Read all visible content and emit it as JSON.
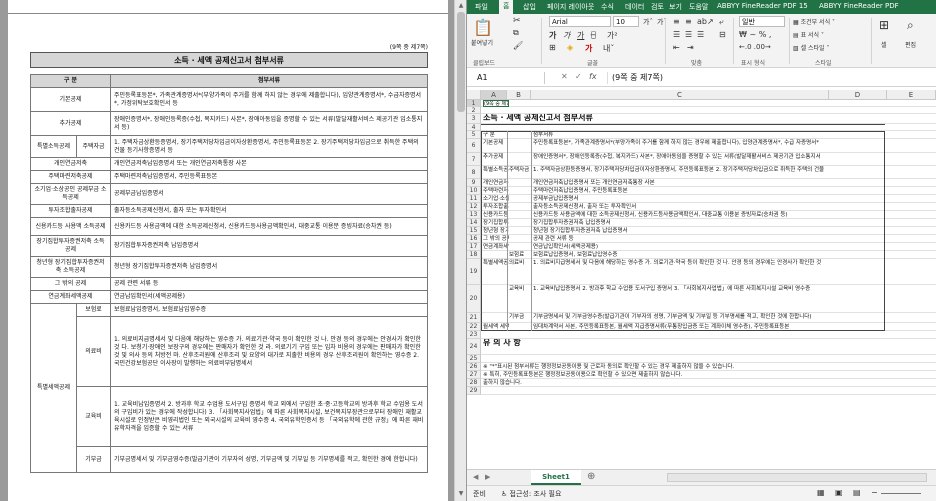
{
  "doc": {
    "page_mark": "(9쪽 중 제7쪽)",
    "title": "소득 · 세액 공제신고서 첨부서류",
    "col1": "구 분",
    "col2": "첨부서류",
    "rows": [
      {
        "a": "기본공제",
        "b": "",
        "c": "주민등록표등본*, 가족관계증명서*(부양가족이 주거를 함께 하지 않는 경우에 제출합니다), 입양관계증명서*, 수급자증명서*, 가정위탁보호확인서 등"
      },
      {
        "a": "추가공제",
        "b": "",
        "c": "장애인증명서*, 장애인등록증(수첩, 복지카드) 사본*, 장애아동임을 증명할 수 있는 서류(발달재활서비스 제공기관 입소통지서 등)"
      },
      {
        "a": "특별소득공제",
        "b": "주택자금",
        "c": "1. 주택자금상환등증명서, 장기주택저당차입금이자상환증명서, 주민등록표등본  2. 장기주택저당차입금으로 취득한 주택의 건물 등기사항증명서 등"
      },
      {
        "a": "개인연금저축",
        "b": "",
        "c": "개인연금저축납입증명서 또는 개인연금저축통장 사본"
      },
      {
        "a": "주택마련저축공제",
        "b": "",
        "c": "주택마련저축납입증명서, 주민등록표등본"
      },
      {
        "a": "소기업·소상공인 공제부금 소득공제",
        "b": "",
        "c": "공제부금납입증명서"
      },
      {
        "a": "투자조합출자공제",
        "b": "",
        "c": "출자등소득공제신청서, 출자 또는 투자확인서"
      },
      {
        "a": "신용카드등 사용액 소득공제",
        "b": "",
        "c": "신용카드등 사용금액에 대한 소득공제신청서, 신용카드등사용금액확인서, 대중교통 이용분 증빙자료(승차권 등)"
      },
      {
        "a": "장기집합투자증권저축 소득공제",
        "b": "",
        "c": "장기집합투자증권저축 납입증명서"
      },
      {
        "a": "청년형 장기집합투자증권저축 소득공제",
        "b": "",
        "c": "청년형 장기집합투자증권저축 납입증명서"
      },
      {
        "a": "그 밖의 공제",
        "b": "",
        "c": "공제 관련 서류 등"
      },
      {
        "a": "연금계좌세액공제",
        "b": "",
        "c": "연금납입확인서(세액공제용)"
      },
      {
        "a": "특별세액공제",
        "b": "보험료",
        "c": "보험료납입증명서, 보험료납입영수증"
      },
      {
        "a": "",
        "b": "의료비",
        "c": "1. 의료비지급명세서 및 다음에 해당하는 영수증  가. 의료기관·약국 등이 확인한 것  나. 안경 등의 경우에는 안경사가 확인한 것  다. 보청기·장애인 보장구의 경우에는 판매자가 확인한 것  라. 의료기기 구입 또는 임차 비용의 경우에는 판매자가 확인한 것 및 의사 등의 처방전  마. 산후조리원에 산후조리 및 요양의 대가로 지출한 비용의 경우 산후조리원이 확인하는 영수증  2. 국민건강보험공단 이사장이 발행하는 의료비부담명세서"
      },
      {
        "a": "",
        "b": "교육비",
        "c": "1. 교육비납입증명서  2. 방과후 학교 수업용 도서구입 증명서 학교 외에서 구입한 초·중·고등학교의 방과후 학교 수업용 도서의 구입비가 있는 경우에 작성합니다)  3. 「사회복지사업법」에 따른 사회복지시설, 보건복지부장관으로부터 장애인 재활교육시설로 인정받은 비영리법인 또는 외국시설의 교육비 영수증  4. 국외유학인증서 등 「국외유학에 관한 규정」에 따른 재비유학자격을 입증할 수 있는 서류"
      },
      {
        "a": "",
        "b": "기부금",
        "c": "기부금명세서 및 기부금영수증(발급기관이 기부자의 성명, 기부금액 및 기부일 등 기부명세를 적고, 확인한 경에 한합니다)"
      }
    ]
  },
  "excel": {
    "tabs": [
      "파일",
      "홈",
      "삽입",
      "페이지 레이아웃",
      "수식",
      "데이터",
      "검토",
      "보기",
      "도움말",
      "ABBYY FineReader PDF 15",
      "ABBYY FineReader PDF"
    ],
    "ribbon": {
      "paste": "붙여넣기",
      "font_name": "Arial",
      "font_size": "10",
      "number_format": "일반",
      "cond_format": "조건부 서식",
      "table_format": "표 서식",
      "cell_style": "셀 스타일",
      "cell": "셀",
      "edit": "편집",
      "groups": [
        "클립보드",
        "글꼴",
        "맞춤",
        "표시 형식",
        "스타일"
      ]
    },
    "namebox": "A1",
    "formula": "(9쪽 중 제7쪽)",
    "fx": "fx",
    "columns": [
      "A",
      "B",
      "C",
      "D",
      "E"
    ],
    "cells": [
      {
        "r": "1",
        "t": "(9쪽 중 제7쪽)"
      },
      {
        "r": "3",
        "t": "소득 · 세액 공제신고서 첨부서류"
      },
      {
        "r": "5a",
        "t": "구 분"
      },
      {
        "r": "5c",
        "t": "첨부서류"
      },
      {
        "r": "6a",
        "t": "기본공제"
      },
      {
        "r": "6c",
        "t": "주민등록표등본*, 가족관계증명서*(부양가족이 주거를 함께 하지 않는 경우에 제출합니다), 입양관계증명서*, 수급 자증명서*"
      },
      {
        "r": "7a",
        "t": "추가공제"
      },
      {
        "r": "7c",
        "t": "장애인증명서*, 장애인등록증(수첩, 복지카드) 사본*, 장애아동임을 증명할 수 있는 서류(발달재활서비스 제공기관 입소통지서"
      },
      {
        "r": "8a",
        "t": "특별소득공제"
      },
      {
        "r": "8b",
        "t": "주택자금"
      },
      {
        "r": "8c",
        "t": "1. 주택자금상환등증명서, 장기주택저당차입금이자상환증명서, 주민등록표등본 2. 장기주택저당차입금으로 취득한 주택의 건물"
      },
      {
        "r": "9a",
        "t": "개인연금저축공제"
      },
      {
        "r": "9c",
        "t": "개인연금저축납입증명서 또는 개인연금저축통장 사본"
      },
      {
        "r": "10a",
        "t": "주택마련저축공제"
      },
      {
        "r": "10c",
        "t": "주택마련저축납입증명서, 주민등록표등본"
      },
      {
        "r": "11a",
        "t": "소기업·소상공인 공"
      },
      {
        "r": "11c",
        "t": "공제부금납입증명서"
      },
      {
        "r": "12a",
        "t": "투자조합출자공제"
      },
      {
        "r": "12c",
        "t": "출자등소득공제신청서, 출자 또는 투자확인서"
      },
      {
        "r": "13a",
        "t": "신용카드등 사용액 소"
      },
      {
        "r": "13c",
        "t": "신용카드등 사용금액에 대한 소득공제신청서, 신용카드등사용금액확인서, 대중교통 이용분 증빙자료(승차권 등)"
      },
      {
        "r": "14a",
        "t": "장기집합투자증권저축"
      },
      {
        "r": "14c",
        "t": "장기집합투자증권저축 납입증명서"
      },
      {
        "r": "15a",
        "t": "청년형 장기집합투자"
      },
      {
        "r": "15c",
        "t": "청년형 장기집합투자증권저축 납입증명서"
      },
      {
        "r": "16a",
        "t": "그 밖의 공제"
      },
      {
        "r": "16c",
        "t": "공제 관련 서류 등"
      },
      {
        "r": "17a",
        "t": "연금계좌세액공제"
      },
      {
        "r": "17c",
        "t": "연금납입확인서(세액공제용)"
      },
      {
        "r": "18b",
        "t": "보험료"
      },
      {
        "r": "18c",
        "t": "보험료납입증명서, 보험료납입영수증"
      },
      {
        "r": "19a",
        "t": "특별세액공제"
      },
      {
        "r": "19b",
        "t": "의료비"
      },
      {
        "r": "19c",
        "t": "1. 의료비지급명세서 및 다음에 해당하는 영수증 가. 의료기관·약국 등이 확인한 것 나. 안경 등의 경우에는 안경사가 확인한 것"
      },
      {
        "r": "20b",
        "t": "교육비"
      },
      {
        "r": "20c",
        "t": "1. 교육비납입증명서 2. 방과후 학교 수업용 도서구입 증명서 3. 「사회복지사업법」에 따른 사회복지시설 교육비 영수증"
      },
      {
        "r": "21b",
        "t": "기부금"
      },
      {
        "r": "21c",
        "t": "기부금명세서 및 기부금영수증(발급기관이 기부자의 성명, 기부금액 및 기부일 등 기부명세를 적고, 확인한 것에 한합니다)"
      },
      {
        "r": "22a",
        "t": "월세액 세액공제"
      },
      {
        "r": "22c",
        "t": "임대차계약서 사본, 주민등록표등본, 월세액 지급증명서류(무통장입금증 또는 계좌이체 영수증), 주민등록표등본"
      },
      {
        "r": "24",
        "t": "유 의 사 항"
      },
      {
        "r": "26",
        "t": "※ \"*\"표시된 첨부서류는 행정정보공동이용 및 근로자 동의로 확인할 수 있는 경우 제출하지 않을 수 있습니다."
      },
      {
        "r": "27",
        "t": "※ 특히, 주민등록표등본은 행정정보공동이용으로 확인할 수 있으면 제출하지 않습니다."
      },
      {
        "r": "28",
        "t": "출하지 않습니다."
      }
    ],
    "row_numbers": [
      "1",
      "2",
      "3",
      "4",
      "5",
      "6",
      "7",
      "8",
      "9",
      "10",
      "11",
      "12",
      "13",
      "14",
      "15",
      "16",
      "17",
      "18",
      "19",
      "20",
      "21",
      "22",
      "23",
      "24",
      "25",
      "26",
      "27",
      "28",
      "29"
    ],
    "sheet_tab": "Sheet1",
    "status_ready": "준비",
    "status_access": "접근성: 조사 필요"
  }
}
